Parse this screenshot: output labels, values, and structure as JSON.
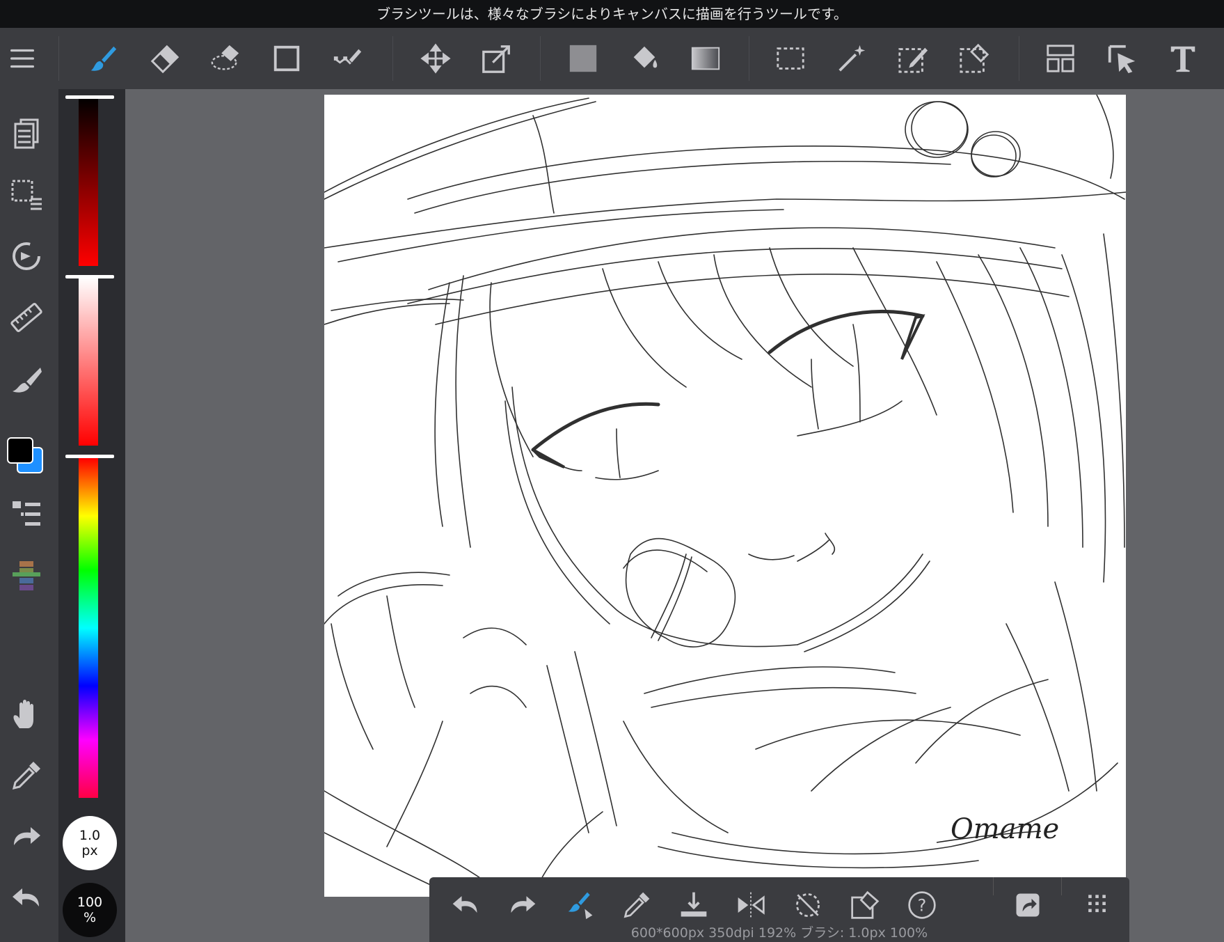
{
  "title_bar": {
    "text": "ブラシツールは、様々なブラシによりキャンバスに描画を行うツールです。"
  },
  "toolbar": {
    "tools": [
      {
        "name": "menu",
        "icon": "menu-icon"
      },
      {
        "name": "brush",
        "icon": "brush-icon",
        "active": true
      },
      {
        "name": "eraser",
        "icon": "eraser-icon"
      },
      {
        "name": "blur",
        "icon": "blur-eraser-icon"
      },
      {
        "name": "shape",
        "icon": "rectangle-icon"
      },
      {
        "name": "vector",
        "icon": "vector-pen-icon"
      },
      {
        "name": "move",
        "icon": "move-icon"
      },
      {
        "name": "transform",
        "icon": "transform-icon"
      },
      {
        "name": "fill-color",
        "icon": "fill-swatch-icon"
      },
      {
        "name": "bucket",
        "icon": "bucket-icon"
      },
      {
        "name": "gradient",
        "icon": "gradient-icon"
      },
      {
        "name": "select",
        "icon": "select-rect-icon"
      },
      {
        "name": "magic-wand",
        "icon": "magic-wand-icon"
      },
      {
        "name": "select-pen",
        "icon": "select-pen-icon"
      },
      {
        "name": "select-eraser",
        "icon": "select-eraser-icon"
      },
      {
        "name": "frame-divider",
        "icon": "frame-divider-icon"
      },
      {
        "name": "operation",
        "icon": "operation-icon"
      },
      {
        "name": "text",
        "icon": "text-icon"
      }
    ]
  },
  "sidebar": {
    "items": [
      "pages-icon",
      "selection-list-icon",
      "rotate-icon",
      "ruler-icon",
      "brush-settings-icon",
      "color-swatch-icon",
      "layers-icon",
      "palette-icon",
      "hand-icon",
      "eyedropper-icon",
      "redo-icon",
      "undo-icon"
    ]
  },
  "color": {
    "primary": "#000000",
    "secondary": "#1e90ff",
    "accent": "#2f9be0"
  },
  "brush": {
    "size_value": "1.0",
    "size_unit": "px",
    "opacity_value": "100",
    "opacity_unit": "%"
  },
  "canvas": {
    "signature": "Omame"
  },
  "bottom_bar": {
    "tools": [
      "undo-icon",
      "redo-icon",
      "brush-switch-icon",
      "eyedropper-icon",
      "import-icon",
      "flip-icon",
      "rotate-reset-icon",
      "eraser-icon",
      "help-icon",
      "share-icon",
      "grid-menu-icon"
    ],
    "status": "600*600px 350dpi 192% ブラシ: 1.0px 100%"
  }
}
